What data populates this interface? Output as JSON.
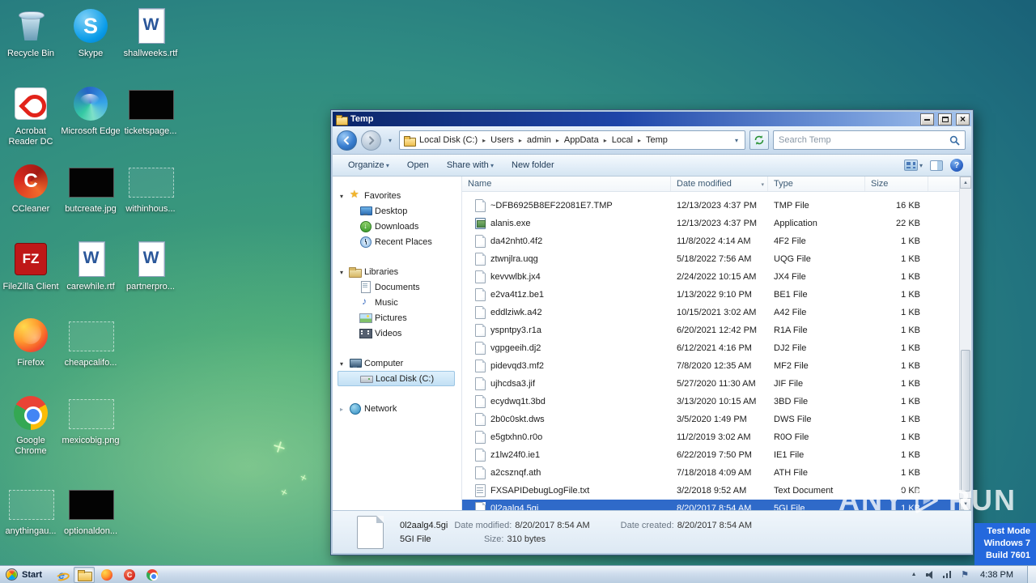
{
  "colors": {
    "selection_blue": "#2f6ac9",
    "titlebar_blue": "#0b2569",
    "testmode_blue": "#2468dd",
    "taskbar_light": "#cfdded"
  },
  "desktop": {
    "icons": [
      {
        "label": "Recycle Bin",
        "icon": "recycle-bin",
        "col": 0,
        "row": 0
      },
      {
        "label": "Skype",
        "icon": "skype",
        "col": 1,
        "row": 0
      },
      {
        "label": "shallweeks.rtf",
        "icon": "word-doc",
        "col": 2,
        "row": 0
      },
      {
        "label": "Acrobat Reader DC",
        "icon": "acrobat",
        "col": 0,
        "row": 1
      },
      {
        "label": "Microsoft Edge",
        "icon": "edge",
        "col": 1,
        "row": 1
      },
      {
        "label": "ticketspage...",
        "icon": "black-image",
        "col": 2,
        "row": 1
      },
      {
        "label": "CCleaner",
        "icon": "ccleaner",
        "col": 0,
        "row": 2
      },
      {
        "label": "butcreate.jpg",
        "icon": "black-image",
        "col": 1,
        "row": 2
      },
      {
        "label": "withinhous...",
        "icon": "broken-image",
        "col": 2,
        "row": 2
      },
      {
        "label": "FileZilla Client",
        "icon": "filezilla",
        "col": 0,
        "row": 3
      },
      {
        "label": "carewhile.rtf",
        "icon": "word-doc",
        "col": 1,
        "row": 3
      },
      {
        "label": "partnerpro...",
        "icon": "word-doc",
        "col": 2,
        "row": 3
      },
      {
        "label": "Firefox",
        "icon": "firefox",
        "col": 0,
        "row": 4
      },
      {
        "label": "cheapcalifo...",
        "icon": "broken-image",
        "col": 1,
        "row": 4
      },
      {
        "label": "Google Chrome",
        "icon": "chrome",
        "col": 0,
        "row": 5
      },
      {
        "label": "mexicobig.png",
        "icon": "broken-image",
        "col": 1,
        "row": 5
      },
      {
        "label": "anythingau...",
        "icon": "broken-image",
        "col": 0,
        "row": 6
      },
      {
        "label": "optionaldon...",
        "icon": "black-image",
        "col": 1,
        "row": 6
      }
    ]
  },
  "window": {
    "title": "Temp",
    "address": {
      "crumbs": [
        "Local Disk (C:)",
        "Users",
        "admin",
        "AppData",
        "Local",
        "Temp"
      ],
      "search_placeholder": "Search Temp"
    },
    "command_bar": [
      {
        "label": "Organize",
        "dropdown": true
      },
      {
        "label": "Open",
        "dropdown": false
      },
      {
        "label": "Share with",
        "dropdown": true
      },
      {
        "label": "New folder",
        "dropdown": false
      }
    ],
    "sidebar": {
      "sections": [
        {
          "label": "Favorites",
          "icon": "star",
          "expanded": true,
          "items": [
            {
              "label": "Desktop",
              "icon": "monitor"
            },
            {
              "label": "Downloads",
              "icon": "download"
            },
            {
              "label": "Recent Places",
              "icon": "clock"
            }
          ]
        },
        {
          "label": "Libraries",
          "icon": "library",
          "expanded": true,
          "items": [
            {
              "label": "Documents",
              "icon": "document"
            },
            {
              "label": "Music",
              "icon": "music"
            },
            {
              "label": "Pictures",
              "icon": "picture"
            },
            {
              "label": "Videos",
              "icon": "video"
            }
          ]
        },
        {
          "label": "Computer",
          "icon": "computer",
          "expanded": true,
          "items": [
            {
              "label": "Local Disk (C:)",
              "icon": "disk",
              "selected": true
            }
          ]
        },
        {
          "label": "Network",
          "icon": "network",
          "expanded": false,
          "items": []
        }
      ]
    },
    "columns": [
      "Name",
      "Date modified",
      "Type",
      "Size"
    ],
    "sort_column": "Date modified",
    "files": [
      {
        "name": "~DFB6925B8EF22081E7.TMP",
        "date": "12/13/2023 4:37 PM",
        "type": "TMP File",
        "size": "16 KB",
        "icon": "page"
      },
      {
        "name": "alanis.exe",
        "date": "12/13/2023 4:37 PM",
        "type": "Application",
        "size": "22 KB",
        "icon": "app"
      },
      {
        "name": "da42nht0.4f2",
        "date": "11/8/2022 4:14 AM",
        "type": "4F2 File",
        "size": "1 KB",
        "icon": "page"
      },
      {
        "name": "ztwnjlra.uqg",
        "date": "5/18/2022 7:56 AM",
        "type": "UQG File",
        "size": "1 KB",
        "icon": "page"
      },
      {
        "name": "kevvwlbk.jx4",
        "date": "2/24/2022 10:15 AM",
        "type": "JX4 File",
        "size": "1 KB",
        "icon": "page"
      },
      {
        "name": "e2va4t1z.be1",
        "date": "1/13/2022 9:10 PM",
        "type": "BE1 File",
        "size": "1 KB",
        "icon": "page"
      },
      {
        "name": "eddlziwk.a42",
        "date": "10/15/2021 3:02 AM",
        "type": "A42 File",
        "size": "1 KB",
        "icon": "page"
      },
      {
        "name": "yspntpy3.r1a",
        "date": "6/20/2021 12:42 PM",
        "type": "R1A File",
        "size": "1 KB",
        "icon": "page"
      },
      {
        "name": "vgpgeeih.dj2",
        "date": "6/12/2021 4:16 PM",
        "type": "DJ2 File",
        "size": "1 KB",
        "icon": "page"
      },
      {
        "name": "pidevqd3.mf2",
        "date": "7/8/2020 12:35 AM",
        "type": "MF2 File",
        "size": "1 KB",
        "icon": "page"
      },
      {
        "name": "ujhcdsa3.jif",
        "date": "5/27/2020 11:30 AM",
        "type": "JIF File",
        "size": "1 KB",
        "icon": "page"
      },
      {
        "name": "ecydwq1t.3bd",
        "date": "3/13/2020 10:15 AM",
        "type": "3BD File",
        "size": "1 KB",
        "icon": "page"
      },
      {
        "name": "2b0c0skt.dws",
        "date": "3/5/2020 1:49 PM",
        "type": "DWS File",
        "size": "1 KB",
        "icon": "page"
      },
      {
        "name": "e5gtxhn0.r0o",
        "date": "11/2/2019 3:02 AM",
        "type": "R0O File",
        "size": "1 KB",
        "icon": "page"
      },
      {
        "name": "z1lw24f0.ie1",
        "date": "6/22/2019 7:50 PM",
        "type": "IE1 File",
        "size": "1 KB",
        "icon": "page"
      },
      {
        "name": "a2csznqf.ath",
        "date": "7/18/2018 4:09 AM",
        "type": "ATH File",
        "size": "1 KB",
        "icon": "page"
      },
      {
        "name": "FXSAPIDebugLogFile.txt",
        "date": "3/2/2018 9:52 AM",
        "type": "Text Document",
        "size": "0 KB",
        "icon": "txt"
      },
      {
        "name": "0l2aalg4.5gi",
        "date": "8/20/2017 8:54 AM",
        "type": "5GI File",
        "size": "1 KB",
        "icon": "page",
        "selected": true
      }
    ],
    "details": {
      "name": "0l2aalg4.5gi",
      "date_modified_label": "Date modified:",
      "date_modified": "8/20/2017 8:54 AM",
      "date_created_label": "Date created:",
      "date_created": "8/20/2017 8:54 AM",
      "file_type": "5GI File",
      "size_label": "Size:",
      "size": "310 bytes"
    }
  },
  "taskbar": {
    "start_label": "Start",
    "pinned": [
      {
        "icon": "internet-explorer"
      },
      {
        "icon": "windows-explorer",
        "active": true
      },
      {
        "icon": "firefox"
      },
      {
        "icon": "ccleaner"
      },
      {
        "icon": "chrome"
      }
    ],
    "tray_icons": [
      "chevron",
      "volume",
      "network",
      "flag"
    ],
    "clock": "4:38 PM"
  },
  "watermark": {
    "brand_left": "ANY",
    "brand_right": "RUN",
    "test_lines": [
      "Test Mode",
      "Windows 7",
      "Build 7601"
    ]
  }
}
